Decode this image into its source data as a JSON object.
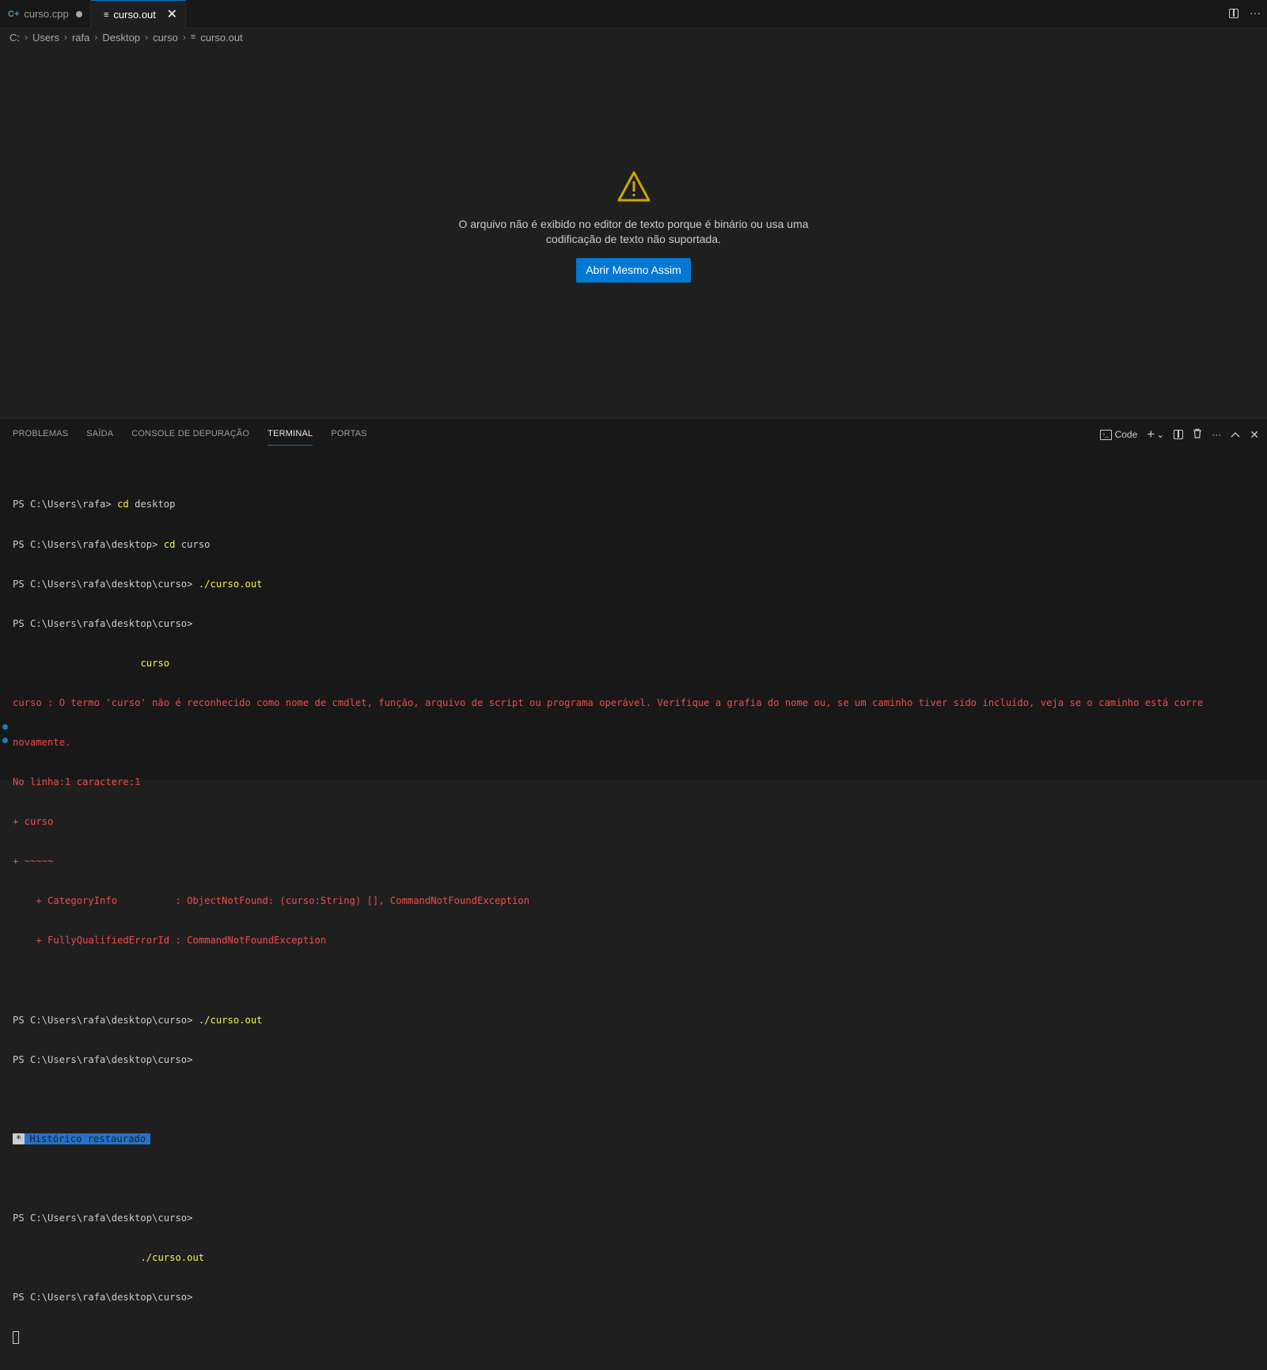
{
  "tabs": [
    {
      "icon": "C+",
      "label": "curso.cpp"
    },
    {
      "icon": "≡",
      "label": "curso.out",
      "close": "✕"
    }
  ],
  "editor_actions": {
    "more": "···"
  },
  "breadcrumb": [
    "C:",
    "Users",
    "rafa",
    "Desktop",
    "curso",
    "curso.out"
  ],
  "breadcrumb_sep": "›",
  "editor_message": {
    "line1": "O arquivo não é exibido no editor de texto porque é binário ou usa uma",
    "line2": "codificação de texto não suportada.",
    "button": "Abrir Mesmo Assim"
  },
  "panel": {
    "tabs": [
      "PROBLEMAS",
      "SAÍDA",
      "CONSOLE DE DEPURAÇÃO",
      "TERMINAL",
      "PORTAS"
    ],
    "terminal_name": "Code",
    "actions": {
      "add": "+",
      "dropdown": "⌄",
      "more": "···",
      "maximize": "^",
      "close": "✕"
    }
  },
  "terminal": {
    "l1_prompt": "PS C:\\Users\\rafa> ",
    "l1_cmd": "cd",
    "l1_arg": " desktop",
    "l2_prompt": "PS C:\\Users\\rafa\\desktop> ",
    "l2_cmd": "cd",
    "l2_arg": " curso",
    "l3_prompt": "PS C:\\Users\\rafa\\desktop\\curso> ",
    "l3_cmd": "./curso.out",
    "l4_prompt": "PS C:\\Users\\rafa\\desktop\\curso>",
    "l5_indent": "                      ",
    "l5_cmd": "curso",
    "err1": "curso : O termo 'curso' não é reconhecido como nome de cmdlet, função, arquivo de script ou programa operável. Verifique a grafia do nome ou, se um caminho tiver sido incluído, veja se o caminho está corre",
    "err2": "novamente.",
    "err3": "No linha:1 caractere:1",
    "err4": "+ curso",
    "err5": "+ ~~~~~",
    "err6": "    + CategoryInfo          : ObjectNotFound: (curso:String) [], CommandNotFoundException",
    "err7": "    + FullyQualifiedErrorId : CommandNotFoundException",
    "l6_prompt": "PS C:\\Users\\rafa\\desktop\\curso> ",
    "l6_cmd": "./curso.out",
    "l7_prompt": "PS C:\\Users\\rafa\\desktop\\curso>",
    "hist_star": "*",
    "hist_label": "Histórico restaurado",
    "l8_prompt": "PS C:\\Users\\rafa\\desktop\\curso>",
    "l9_indent": "                      ",
    "l9_cmd": "./curso.out",
    "l10_prompt": "PS C:\\Users\\rafa\\desktop\\curso>"
  },
  "colors": {
    "accent": "#0078d4",
    "command": "#f5f543",
    "error": "#f14c4c",
    "warning": "#cca700",
    "history": "#2472c8"
  }
}
